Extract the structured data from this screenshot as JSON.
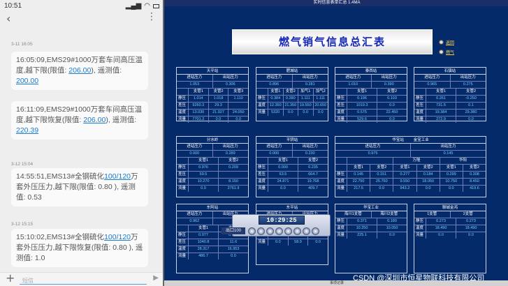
{
  "phone": {
    "time": "10:51",
    "status_icons": "‡ … ◉ ★ ▣ ▮",
    "back_icon": "back-arrow-icon",
    "menu_icon": "⋮",
    "input_placeholder": "短信",
    "plus": "+",
    "send": "▶",
    "messages": [
      {
        "date": "3-11 16:05",
        "parts": [
          {
            "text": "16:05:09,EMS29#1000万套车间高压温度,越下限(限值: "
          },
          {
            "link": "206.00"
          },
          {
            "text": "), 遥测值: "
          },
          {
            "link": "200.00"
          }
        ]
      },
      {
        "date": "",
        "parts": [
          {
            "text": "16:11:09,EMS29#1000万套车间高压温度,越下限恢复(限值: "
          },
          {
            "link": "206.00"
          },
          {
            "text": "), 遥测值: "
          },
          {
            "link": "220.39"
          }
        ]
      },
      {
        "date": "3-12 15:04",
        "parts": [
          {
            "text": "14:55:51,EMS13#全钢硫化"
          },
          {
            "link": "100/120"
          },
          {
            "text": "万套外压压力,越下限(限值: 0.80 ), 遥测值: 0.53"
          }
        ]
      },
      {
        "date": "3-12 15:15",
        "parts": [
          {
            "text": "15:10:02,EMS13#全钢硫化"
          },
          {
            "link": "100/120"
          },
          {
            "text": "万套外压压力,越下限恢复(限值: 0.80 ), 遥测值: 1.0"
          }
        ]
      }
    ]
  },
  "window": {
    "title": "实时信息表单汇总 1.4MA",
    "banner": "燃气销气信息总汇表",
    "radio": [
      "返回",
      "燃气"
    ],
    "toolbar_time": "10:29:25",
    "toolbar_label": "出口100",
    "watermark": "CSDN @深圳市恒星物联科技有限公司",
    "bottom_text": "事项记录"
  },
  "stations": [
    {
      "name": "天平站",
      "in_label": "进站压力",
      "out_label": "出站压力",
      "in": "1.053",
      "out": "0.306",
      "subs": [
        "支管1",
        "支管2",
        "支管3"
      ],
      "rows": [
        [
          "静压",
          "1.014",
          "1.018",
          "1.110"
        ],
        [
          "差压",
          "9260.3",
          "29.3",
          ""
        ],
        [
          "温度",
          "13.030",
          "21.927",
          "24.050"
        ],
        [
          "流量",
          "7701.3",
          "0.0",
          "0.0"
        ]
      ]
    },
    {
      "name": "肥城站",
      "in_label": "进站压力",
      "out_label": "出站压力",
      "in": "0.896",
      "out": "0.281",
      "subs": [
        "支管1",
        "支管2",
        "加气1",
        "加气2"
      ],
      "rows": [
        [
          "静压",
          "0.384",
          "0.280",
          "1.111",
          "1.111"
        ],
        [
          "温度",
          "12.350",
          "21.350",
          "19.550",
          "20.650"
        ],
        [
          "流量",
          "5320",
          "0.0",
          "0.0",
          "0.0"
        ]
      ]
    },
    {
      "name": "泰西站",
      "in_label": "进站压力",
      "out_label": "出站压力",
      "in": "1.010",
      "out": "0.390",
      "subs": [
        "支管1",
        "支管2"
      ],
      "rows": [
        [
          "静压",
          "0.196",
          "0.103"
        ],
        [
          "差压",
          "1019.3",
          "0.0"
        ],
        [
          "温度",
          "0.575",
          "22.450"
        ],
        [
          "流量",
          "529.6",
          "0.0"
        ]
      ]
    },
    {
      "name": "石镇站",
      "in_label": "进站压力",
      "out_label": "出站压力",
      "in": "0.965",
      "out": "0.275",
      "subs": [
        "支管1",
        "支管2"
      ],
      "rows": [
        [
          "静压",
          "0.261",
          "-0.250"
        ],
        [
          "差压",
          "731.5",
          "0.1"
        ],
        [
          "温度",
          "19.384",
          "29.380"
        ],
        [
          "流量",
          "272.9",
          "0.0"
        ]
      ]
    },
    {
      "name": "分水岭",
      "in_label": "进站压力",
      "out_label": "出站压力",
      "in": "0.000",
      "out": "0.289",
      "subs": [
        "支管1",
        "支管2"
      ],
      "rows": [
        [
          "静压",
          "0.976",
          "0.209"
        ],
        [
          "差压",
          "59.5",
          ""
        ],
        [
          "温度",
          "10.270",
          "8.150"
        ],
        [
          "流量",
          "0.0",
          "2761.9"
        ]
      ]
    },
    {
      "name": "平阴站",
      "in_label": "进站压力",
      "out_label": "出站压力",
      "in": "0.000",
      "out": "0.230",
      "subs": [
        "支管1",
        "支管2"
      ],
      "rows": [
        [
          "静压",
          "0.000",
          "0.235"
        ],
        [
          "差压",
          "63.5",
          "664.7"
        ],
        [
          "温度",
          "24.871",
          "19.768"
        ],
        [
          "流量",
          "0.0",
          "409.7"
        ]
      ]
    },
    {
      "name": "华宝站",
      "name2": "金宝工业",
      "in_label": "进站压力",
      "out_label": "出站压力",
      "in": "0.975",
      "out": "0.145",
      "groups": [
        "",
        "万隆",
        "华阳"
      ],
      "subs": [
        "支管1",
        "支管2",
        "支管1",
        "支管2",
        "支管1",
        "支管2"
      ],
      "rows": [
        [
          "静压",
          "0.145",
          "0.151",
          "0.277",
          "0.184",
          "0.299",
          "0.308"
        ],
        [
          "温度",
          "22.750",
          "25.750",
          "9.550",
          "18.050",
          "10.750",
          "8.450"
        ],
        [
          "流量",
          "217.5",
          "0.0",
          "943.2",
          "0.0",
          "0.0",
          "419.6"
        ]
      ]
    },
    {
      "name": "东阿站",
      "in_label": "进站压力",
      "out_label": "出站压力",
      "in": "0.962",
      "out": "",
      "subs": [
        "支管1",
        "支管2"
      ],
      "rows": [
        [
          "静压",
          "0.977",
          "0.929"
        ],
        [
          "差压",
          "1040.8",
          "11.6"
        ],
        [
          "温度",
          "28.317",
          "16.953"
        ],
        [
          "流量",
          "486.7",
          "0.0"
        ]
      ]
    },
    {
      "name": "东平站",
      "in_label": "进站压力",
      "out_label": "出站压力",
      "in": "",
      "out": "",
      "subs": [
        "支管1",
        "支管2",
        "支管3"
      ],
      "rows": [
        [
          "静压",
          "0.233",
          "0.223",
          "0.223"
        ],
        [
          "温度",
          "22.950",
          "23.150",
          "21.750"
        ],
        [
          "流量",
          "0.0",
          "58.9",
          "0.0"
        ]
      ]
    },
    {
      "name": "华宝工业",
      "in_label": "海川1支管",
      "out_label": "海川2支管",
      "in": "",
      "out": "",
      "subs": [],
      "rows": [
        [
          "静压",
          "0.371",
          "0.180"
        ],
        [
          "温度",
          "10.250",
          "10.050"
        ],
        [
          "流量",
          "225.1",
          "0.0"
        ]
      ]
    },
    {
      "name": "聊城金鸿",
      "in_label": "1支管",
      "out_label": "2支管",
      "in": "",
      "out": "",
      "subs": [],
      "rows": [
        [
          "静压",
          "0.273",
          "0.273"
        ],
        [
          "温度",
          "18.490",
          "18.490"
        ],
        [
          "流量",
          "0.0",
          "0.0"
        ]
      ]
    }
  ]
}
